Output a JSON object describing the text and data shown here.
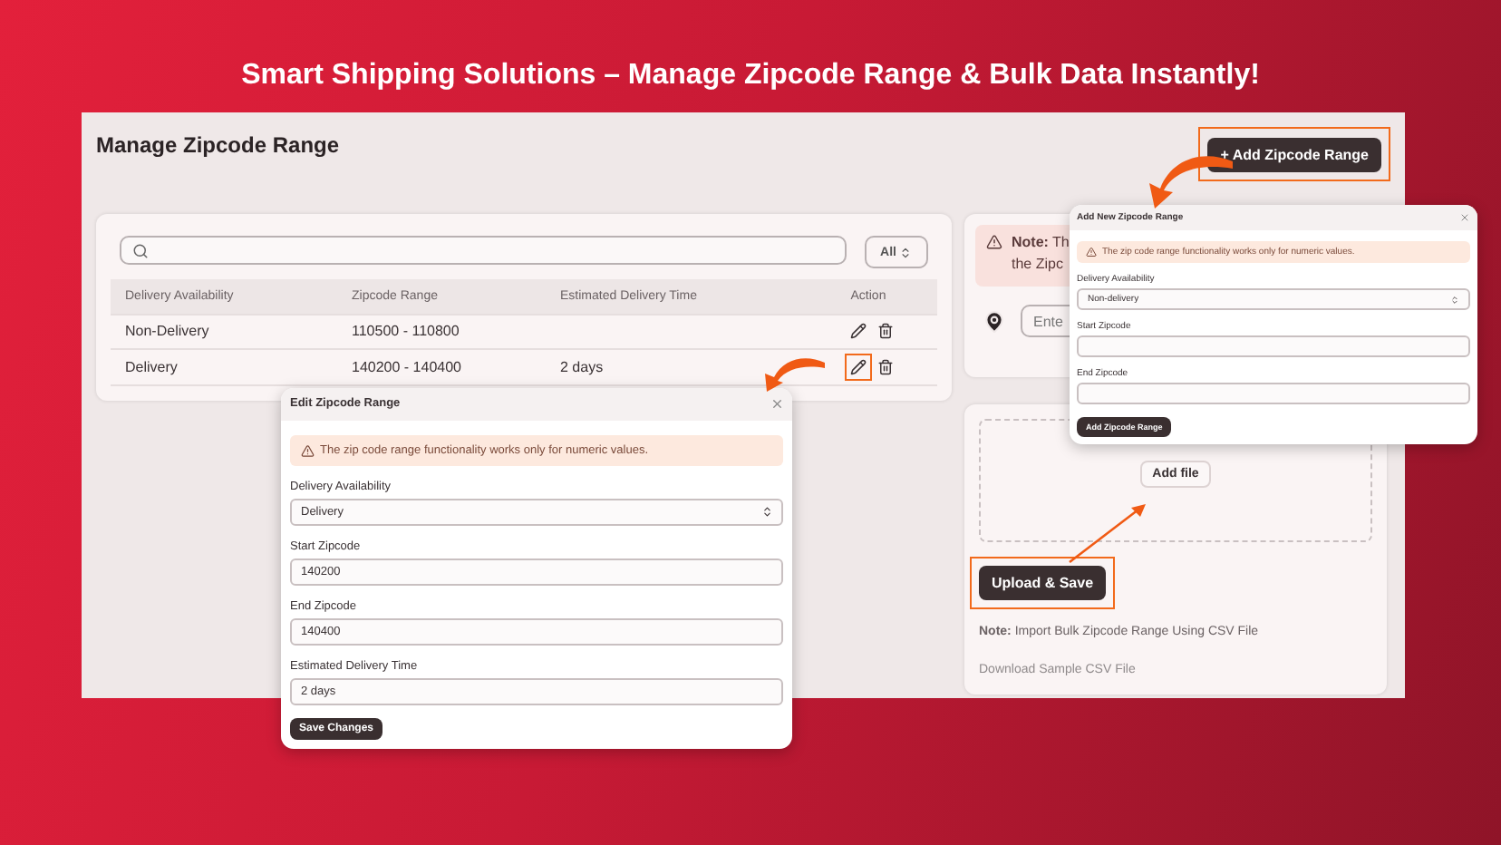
{
  "headline": "Smart Shipping Solutions – Manage Zipcode Range & Bulk Data Instantly!",
  "page": {
    "title": "Manage Zipcode Range",
    "add_button": "+ Add Zipcode Range"
  },
  "filter": {
    "value": "All"
  },
  "table": {
    "columns": [
      "Delivery Availability",
      "Zipcode Range",
      "Estimated Delivery Time",
      "Action"
    ],
    "rows": [
      {
        "availability": "Non-Delivery",
        "range": "110500 - 110800",
        "highlighted": false
      },
      {
        "availability": "Delivery",
        "range": "140200 - 140400",
        "time": "2 days",
        "highlighted": true
      }
    ]
  },
  "note_card": {
    "lines": [
      "**Note:** Th",
      "the Zipc"
    ],
    "location_placeholder": "Ente"
  },
  "upload": {
    "add_file": "Add file",
    "upload_button": "Upload & Save",
    "note": "**Note:** Import Bulk Zipcode Range Using CSV File",
    "download_link": "Download Sample CSV File"
  },
  "add_modal": {
    "title": "Add New Zipcode Range",
    "warning": "The zip code range functionality works only for numeric values.",
    "fields": [
      {
        "label": "Delivery Availability",
        "kind": "select",
        "value": "Non-delivery"
      },
      {
        "label": "Start Zipcode",
        "kind": "text"
      },
      {
        "label": "End Zipcode",
        "kind": "text"
      }
    ],
    "submit": "Add Zipcode Range"
  },
  "edit_modal": {
    "title": "Edit Zipcode Range",
    "warning": "The zip code range functionality works only for numeric values.",
    "fields": [
      {
        "label": "Delivery Availability",
        "kind": "select",
        "value": "Delivery"
      },
      {
        "label": "Start Zipcode",
        "kind": "text",
        "value": "140200"
      },
      {
        "label": "End Zipcode",
        "kind": "text",
        "value": "140400"
      },
      {
        "label": "Estimated Delivery Time",
        "kind": "text",
        "value": "2 days"
      }
    ],
    "submit": "Save Changes"
  }
}
